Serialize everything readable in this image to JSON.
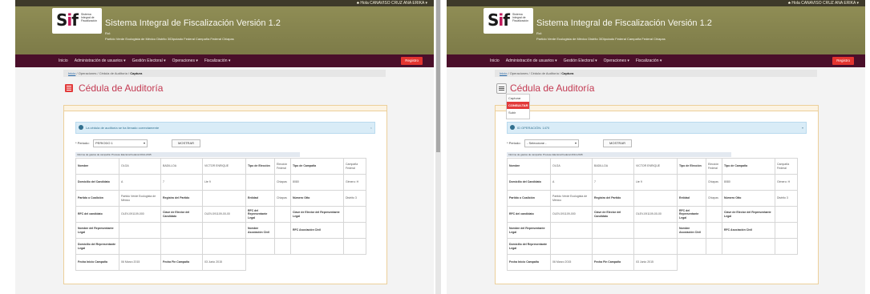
{
  "topbar": {
    "user": "♣ Hola CANAVISO CRUZ ANA ERIKA ▾"
  },
  "header": {
    "logo_text": "Sif",
    "logo_sub": "Sistema Integral de Fiscalización",
    "title": "Sistema Integral de Fiscalización Versión 1.2",
    "rol": "Rol:",
    "partido": "Partido Verde Ecologista de México Distrito 3/Diputado Federal Campaña Federal Chiapas"
  },
  "nav": {
    "items": [
      "Inicio",
      "Administración de usuarios ▾",
      "Gestión Electoral ▾",
      "Operaciones ▾",
      "Fiscalización ▾"
    ],
    "registro": "Registro"
  },
  "breadcrumb": {
    "inicio": "Inicio",
    "operaciones": "Operaciones",
    "cedula": "Cédula de Auditoría",
    "current": "Captura"
  },
  "page_title": "Cédula de Auditoría",
  "dropdown": {
    "items": [
      "Capturar",
      "CONSULTAR",
      "Subir"
    ]
  },
  "left": {
    "alert": "La cédula de auditoría se ha llenado correctamente",
    "periodo_label": "* Periodo:",
    "periodo_value": "PERIODO 1",
    "mostrar": "MOSTRAR",
    "info": "Informe de gastos de campaña: Proceso Electoral Federal 2014-2015"
  },
  "right": {
    "alert": "ID OPERACIÓN: 1470",
    "periodo_label": "* Periodo:",
    "periodo_value": "- Seleccione -",
    "mostrar": "MOSTRAR",
    "info": "Informe de gastos de campaña: Proceso Electoral Federal 2014-2015"
  },
  "table": {
    "rows": [
      [
        "Nombre",
        "OLGA",
        "BADILLOA",
        "VICTOR ENRIQUE",
        "Tipo de Elección",
        "Elección Federal",
        "Tipo de Campaña",
        "Campaña Federal"
      ],
      [
        "Domicilio del Candidato",
        "A",
        "7",
        "Lte 9",
        "",
        "Chiapas",
        "8080",
        "Género: H"
      ],
      [
        "Partido o Coalición",
        "Partido Verde Ecologista de México",
        "Registro del Partido",
        "",
        "Entidad",
        "Chiapas",
        "Número Otto",
        "Distrito 3"
      ],
      [
        "RFC del candidato",
        "OLEV-091109-000",
        "Clave de Elector del Candidato",
        "OLEV-091109-00-00",
        "RFC del Representante Legal",
        "",
        "Clave de Elector del Representante Legal",
        ""
      ],
      [
        "Nombre del Representante Legal",
        "",
        "",
        "",
        "Nombre Asociación Civil",
        "",
        "RFC Asociación Civil",
        ""
      ],
      [
        "Domicilio del Representante Legal",
        "",
        "",
        "",
        "",
        "",
        "",
        ""
      ],
      [
        "Fecha Inicio Campaña",
        "06 Marzo 2015",
        "Fecha Fin Campaña",
        "03 Junio 2015",
        "",
        "",
        "",
        ""
      ]
    ]
  },
  "colors": {
    "banner": "#8a8850",
    "navbar": "#4a0f2a",
    "accent": "#e23a3a",
    "title": "#c33a52"
  }
}
